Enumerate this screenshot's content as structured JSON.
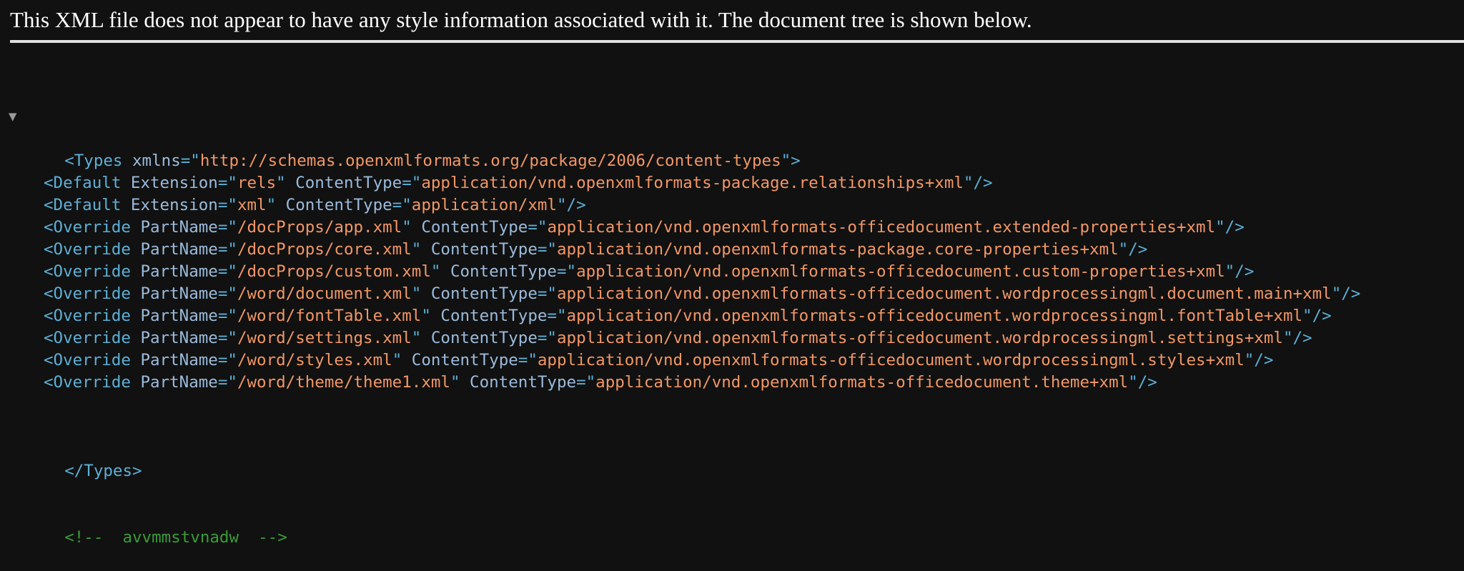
{
  "banner": {
    "text": "This XML file does not appear to have any style information associated with it. The document tree is shown below."
  },
  "tree": {
    "toggle_symbol": "▼",
    "root": {
      "open_prefix": "<Types ",
      "attr": "xmlns",
      "eq_quote": "=\"",
      "value": "http://schemas.openxmlformats.org/package/2006/content-types",
      "open_suffix": "\">",
      "close": "</Types>"
    },
    "children": [
      {
        "tag": "<Default ",
        "a1": "Extension",
        "v1": "rels",
        "a2": "ContentType",
        "v2": "application/vnd.openxmlformats-package.relationships+xml"
      },
      {
        "tag": "<Default ",
        "a1": "Extension",
        "v1": "xml",
        "a2": "ContentType",
        "v2": "application/xml"
      },
      {
        "tag": "<Override ",
        "a1": "PartName",
        "v1": "/docProps/app.xml",
        "a2": "ContentType",
        "v2": "application/vnd.openxmlformats-officedocument.extended-properties+xml"
      },
      {
        "tag": "<Override ",
        "a1": "PartName",
        "v1": "/docProps/core.xml",
        "a2": "ContentType",
        "v2": "application/vnd.openxmlformats-package.core-properties+xml"
      },
      {
        "tag": "<Override ",
        "a1": "PartName",
        "v1": "/docProps/custom.xml",
        "a2": "ContentType",
        "v2": "application/vnd.openxmlformats-officedocument.custom-properties+xml"
      },
      {
        "tag": "<Override ",
        "a1": "PartName",
        "v1": "/word/document.xml",
        "a2": "ContentType",
        "v2": "application/vnd.openxmlformats-officedocument.wordprocessingml.document.main+xml"
      },
      {
        "tag": "<Override ",
        "a1": "PartName",
        "v1": "/word/fontTable.xml",
        "a2": "ContentType",
        "v2": "application/vnd.openxmlformats-officedocument.wordprocessingml.fontTable+xml"
      },
      {
        "tag": "<Override ",
        "a1": "PartName",
        "v1": "/word/settings.xml",
        "a2": "ContentType",
        "v2": "application/vnd.openxmlformats-officedocument.wordprocessingml.settings+xml"
      },
      {
        "tag": "<Override ",
        "a1": "PartName",
        "v1": "/word/styles.xml",
        "a2": "ContentType",
        "v2": "application/vnd.openxmlformats-officedocument.wordprocessingml.styles+xml"
      },
      {
        "tag": "<Override ",
        "a1": "PartName",
        "v1": "/word/theme/theme1.xml",
        "a2": "ContentType",
        "v2": "application/vnd.openxmlformats-officedocument.theme+xml"
      }
    ],
    "comment": "<!--  avvmmstvnadw  -->"
  },
  "colors": {
    "background": "#111111",
    "tag": "#5db0d7",
    "attribute": "#9bbbdc",
    "value": "#f29766",
    "comment": "#3a9b3a"
  }
}
